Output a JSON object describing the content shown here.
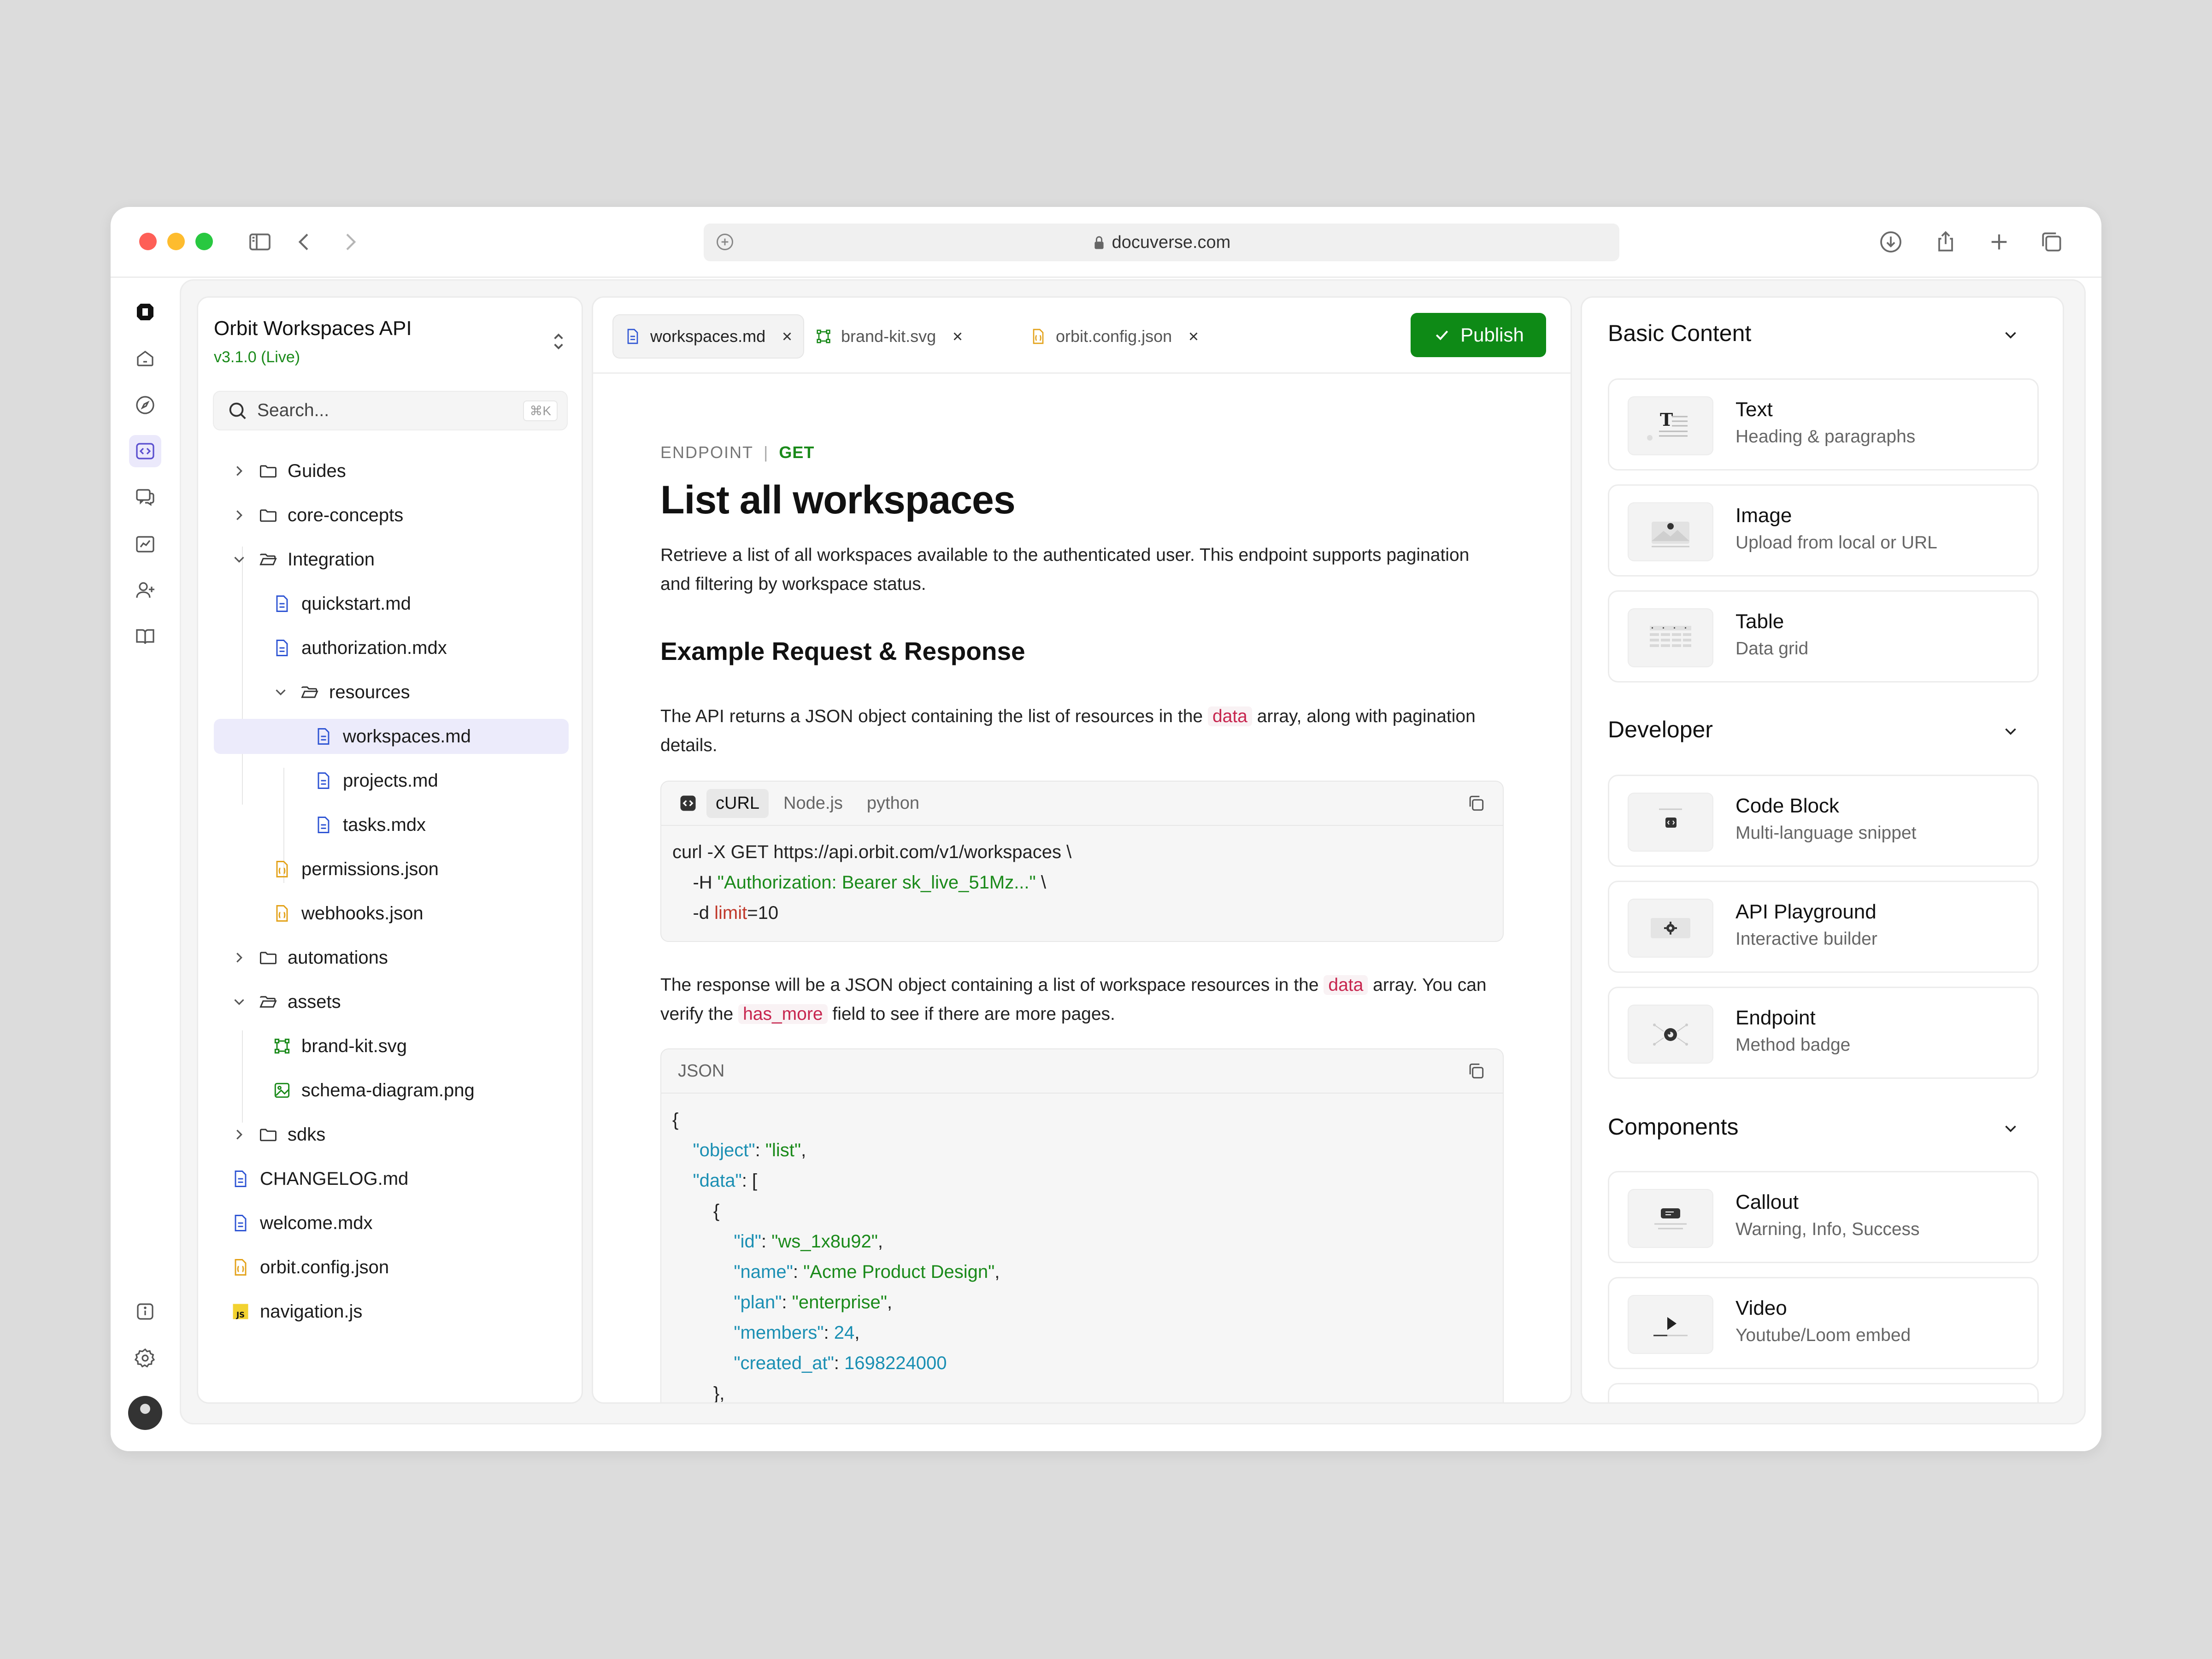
{
  "browser": {
    "url": "docuverse.com"
  },
  "project": {
    "title": "Orbit Workspaces API",
    "version": "v3.1.0 (Live)"
  },
  "search": {
    "placeholder": "Search...",
    "shortcut": "⌘K"
  },
  "tree": [
    {
      "label": "Guides",
      "type": "folder",
      "expanded": false
    },
    {
      "label": "core-concepts",
      "type": "folder",
      "expanded": false
    },
    {
      "label": "Integration",
      "type": "folder",
      "expanded": true
    },
    {
      "label": "quickstart.md",
      "type": "md"
    },
    {
      "label": "authorization.mdx",
      "type": "md"
    },
    {
      "label": "resources",
      "type": "folder",
      "expanded": true
    },
    {
      "label": "workspaces.md",
      "type": "md",
      "selected": true
    },
    {
      "label": "projects.md",
      "type": "md"
    },
    {
      "label": "tasks.mdx",
      "type": "md"
    },
    {
      "label": "permissions.json",
      "type": "json"
    },
    {
      "label": "webhooks.json",
      "type": "json"
    },
    {
      "label": "automations",
      "type": "folder",
      "expanded": false
    },
    {
      "label": "assets",
      "type": "folder",
      "expanded": true
    },
    {
      "label": "brand-kit.svg",
      "type": "svg"
    },
    {
      "label": "schema-diagram.png",
      "type": "png"
    },
    {
      "label": "sdks",
      "type": "folder",
      "expanded": false
    },
    {
      "label": "CHANGELOG.md",
      "type": "md"
    },
    {
      "label": "welcome.mdx",
      "type": "md"
    },
    {
      "label": "orbit.config.json",
      "type": "json"
    },
    {
      "label": "navigation.js",
      "type": "js"
    }
  ],
  "tabs": [
    {
      "label": "workspaces.md",
      "icon": "md-file-icon",
      "active": true
    },
    {
      "label": "brand-kit.svg",
      "icon": "svg-file-icon",
      "active": false
    },
    {
      "label": "orbit.config.json",
      "icon": "json-file-icon",
      "active": false
    }
  ],
  "publish_label": "Publish",
  "doc": {
    "eyebrow": "ENDPOINT",
    "method": "GET",
    "title": "List all workspaces",
    "intro": "Retrieve a list of all workspaces available to the authenticated user. This endpoint supports pagination and filtering by workspace status.",
    "subheading": "Example Request & Response",
    "para1_a": "The API returns a JSON object containing the list of resources in the",
    "para1_code": "data",
    "para1_b": "array, along with pagination details.",
    "para2_a": "The response will be a JSON object containing a list of workspace resources in the",
    "para2_code1": "data",
    "para2_b": "array. You can verify the",
    "para2_code2": "has_more",
    "para2_c": "field to see if there are more pages.",
    "code_tabs": [
      "cURL",
      "Node.js",
      "python"
    ],
    "curl_line1": "curl -X GET https://api.orbit.com/v1/workspaces \\",
    "curl_h_flag": "-H",
    "curl_h_value": "\"Authorization: Bearer sk_live_51Mz...\"",
    "curl_h_tail": " \\",
    "curl_d_flag": "-d",
    "curl_d_key": "limit",
    "curl_d_value": "=10",
    "json_label": "JSON",
    "json": {
      "object_key": "\"object\"",
      "object_val": "\"list\"",
      "data_key": "\"data\"",
      "id_key": "\"id\"",
      "id_val": "\"ws_1x8u92\"",
      "name_key": "\"name\"",
      "name_val": "\"Acme Product Design\"",
      "plan_key": "\"plan\"",
      "plan_val": "\"enterprise\"",
      "members_key": "\"members\"",
      "members_val": "24",
      "created_key": "\"created_at\"",
      "created_val": "1698224000"
    }
  },
  "blocks": {
    "basic": {
      "title": "Basic Content",
      "items": [
        {
          "title": "Text",
          "subtitle": "Heading & paragraphs"
        },
        {
          "title": "Image",
          "subtitle": "Upload from local or URL"
        },
        {
          "title": "Table",
          "subtitle": "Data grid"
        }
      ]
    },
    "developer": {
      "title": "Developer",
      "items": [
        {
          "title": "Code Block",
          "subtitle": "Multi-language snippet"
        },
        {
          "title": "API Playground",
          "subtitle": "Interactive builder"
        },
        {
          "title": "Endpoint",
          "subtitle": "Method badge"
        }
      ]
    },
    "components": {
      "title": "Components",
      "items": [
        {
          "title": "Callout",
          "subtitle": "Warning, Info, Success"
        },
        {
          "title": "Video",
          "subtitle": "Youtube/Loom embed"
        }
      ]
    }
  },
  "colors": {
    "accent": "#5a4fcf",
    "publish": "#0e8a16",
    "method_get": "#1a8a1a",
    "md_icon": "#2f55d4",
    "json_icon": "#e3a21a",
    "asset_icon": "#1a8a1a"
  }
}
